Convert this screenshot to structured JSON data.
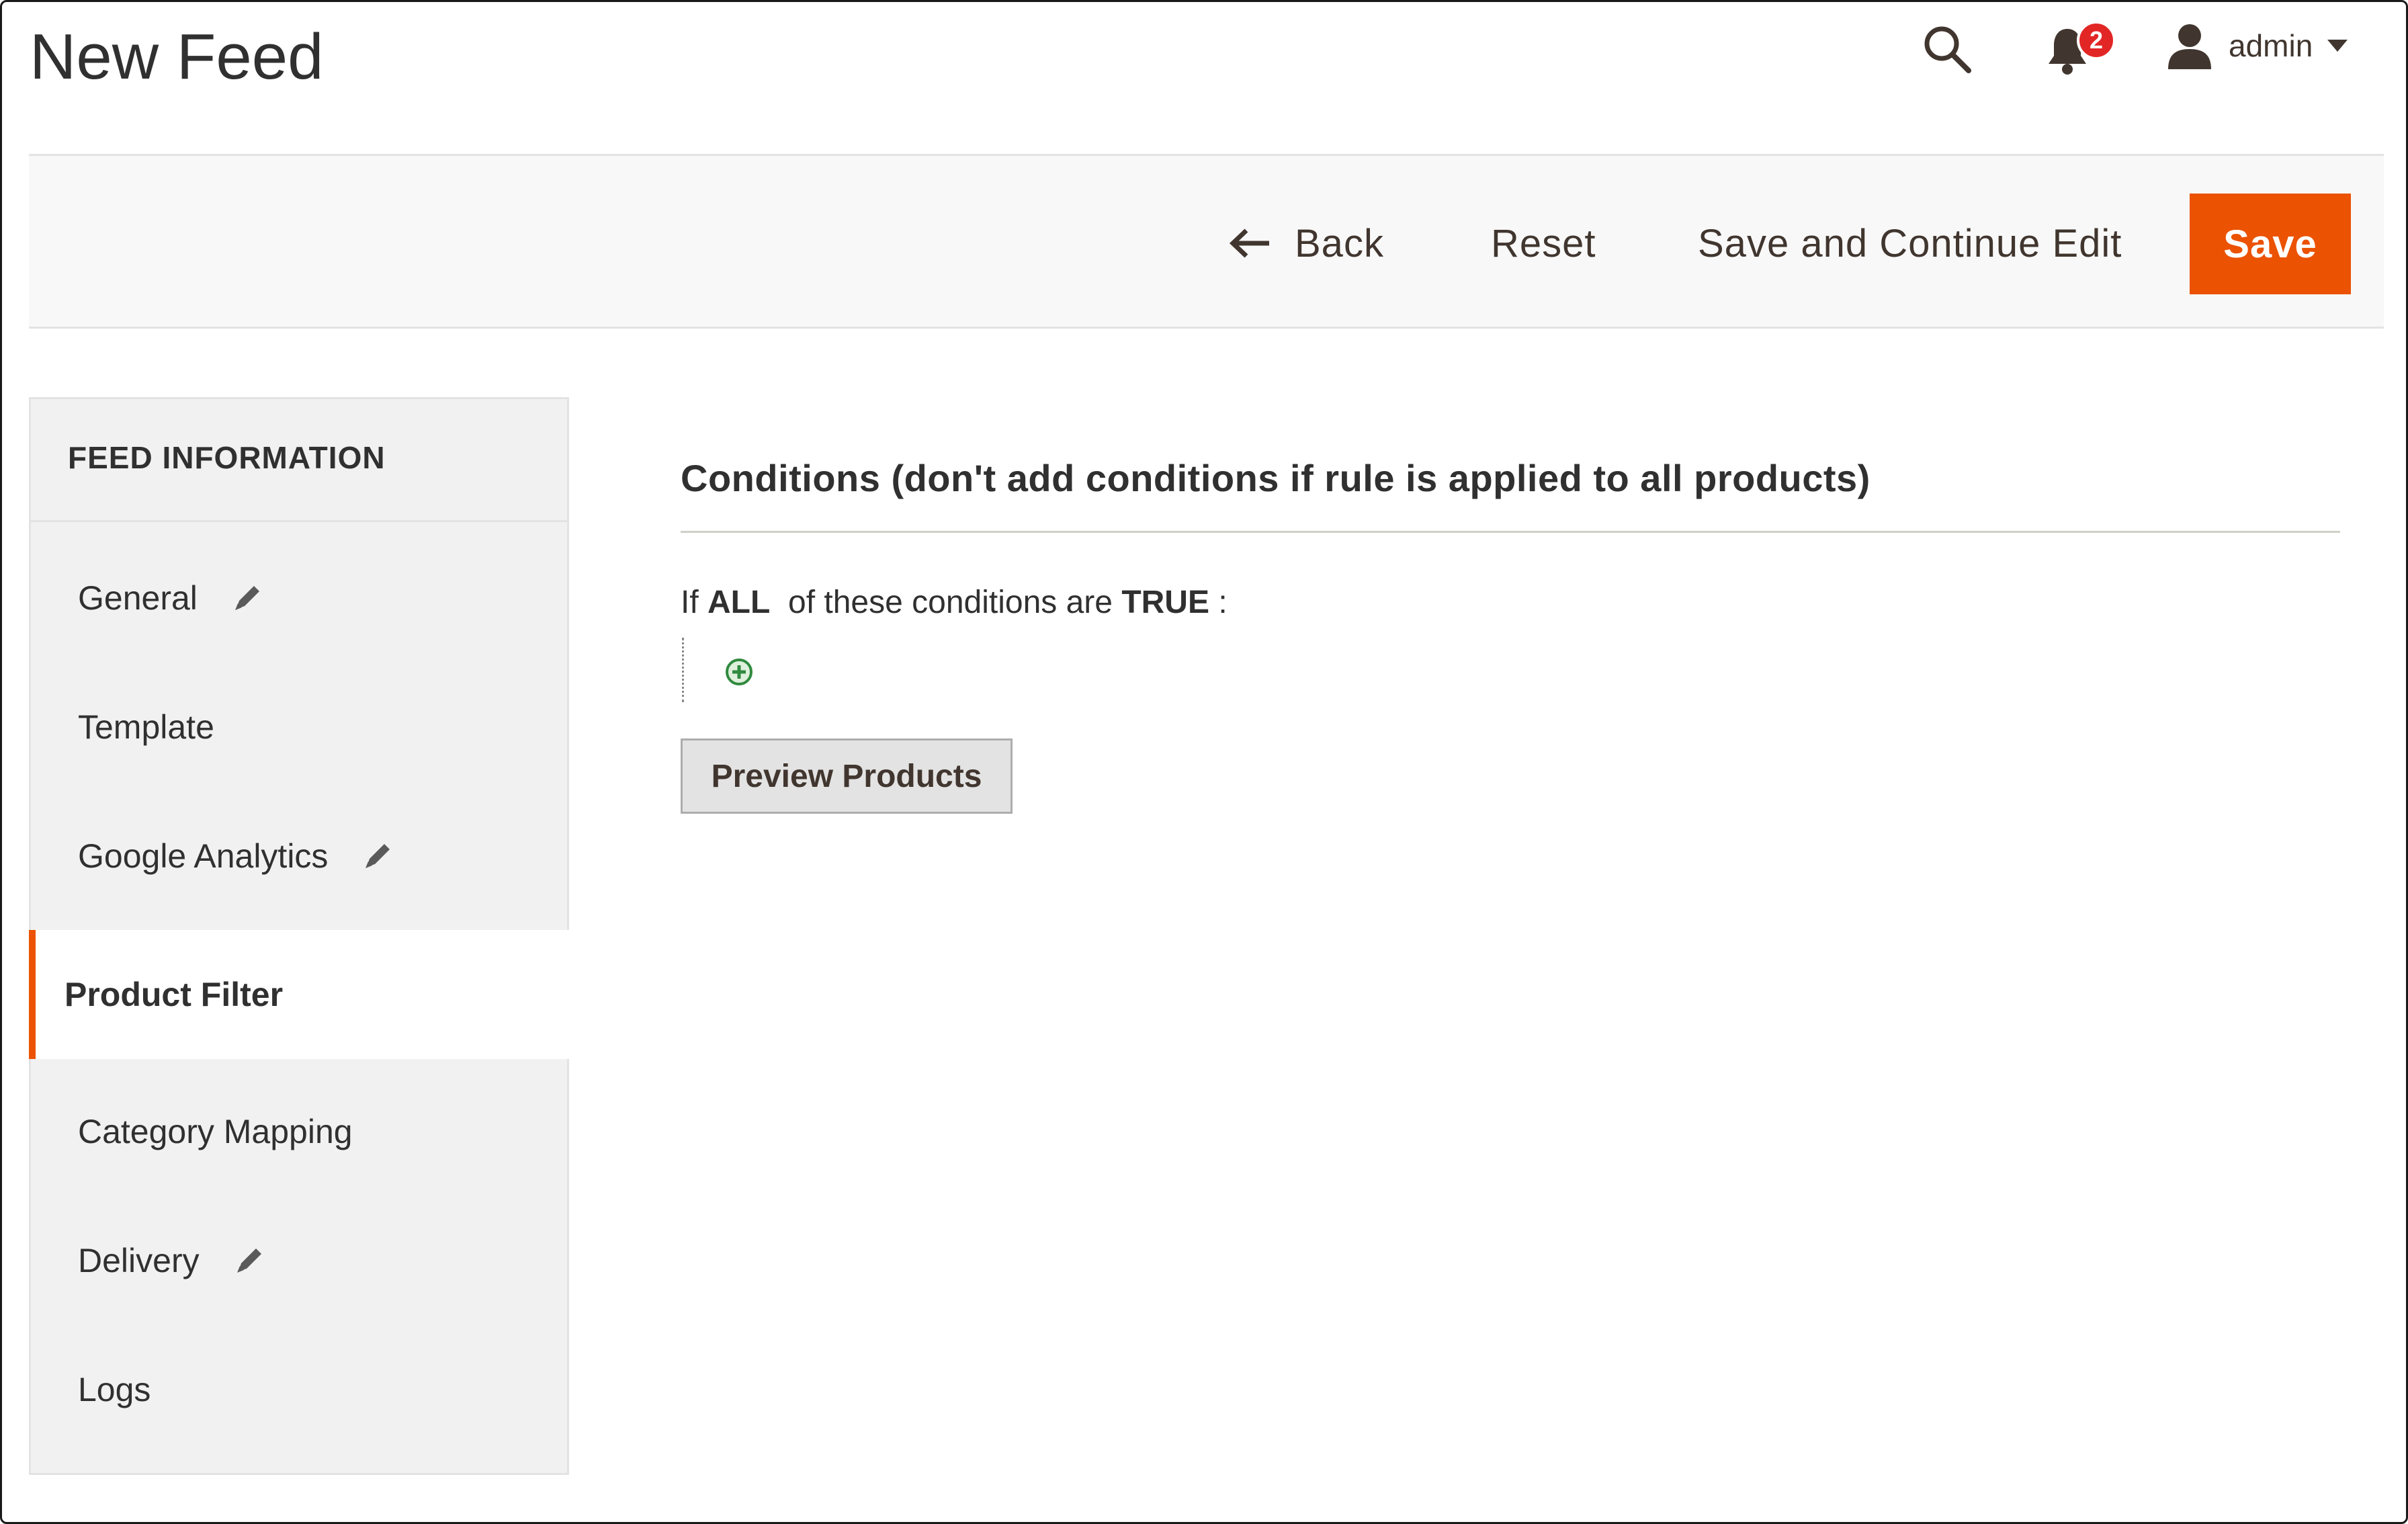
{
  "header": {
    "title": "New Feed",
    "notification_count": "2",
    "user_name": "admin"
  },
  "toolbar": {
    "back_label": "Back",
    "reset_label": "Reset",
    "save_continue_label": "Save and Continue Edit",
    "save_label": "Save"
  },
  "sidebar": {
    "title": "FEED INFORMATION",
    "items": [
      {
        "label": "General",
        "edited": true
      },
      {
        "label": "Template",
        "edited": false
      },
      {
        "label": "Google Analytics",
        "edited": true
      },
      {
        "label": "Product Filter",
        "edited": false,
        "active": true
      },
      {
        "label": "Category Mapping",
        "edited": false
      },
      {
        "label": "Delivery",
        "edited": true
      },
      {
        "label": "Logs",
        "edited": false
      }
    ]
  },
  "conditions": {
    "title": "Conditions (don't add conditions if rule is applied to all products)",
    "prefix": "If ",
    "aggregator": "ALL",
    "middle": "  of these conditions are ",
    "value": "TRUE",
    "suffix": " :",
    "preview_label": "Preview Products"
  },
  "colors": {
    "accent": "#eb5202",
    "badge": "#e22626",
    "add_icon": "#2f8a3f"
  },
  "icons": {
    "search": "search-icon",
    "notifications": "bell-icon",
    "user": "user-icon",
    "edit": "pencil-icon",
    "add": "add-condition-icon",
    "back": "arrow-left-icon"
  }
}
